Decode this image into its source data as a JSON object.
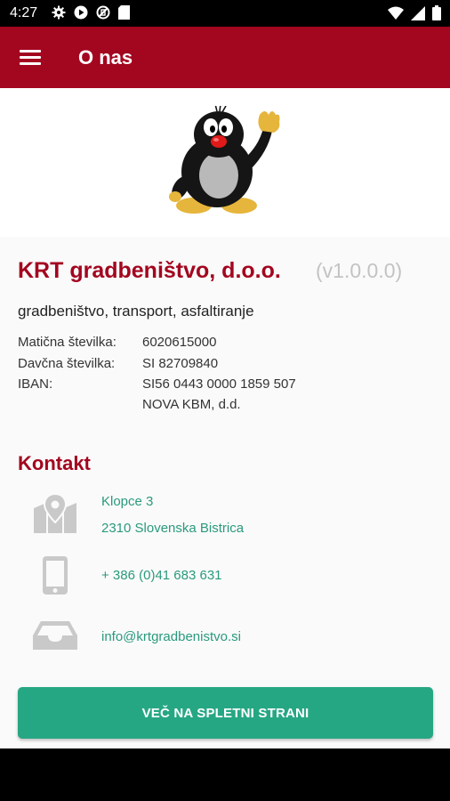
{
  "status_bar": {
    "time": "4:27",
    "left_icons": [
      "gear-icon",
      "play-icon",
      "no-sim-icon",
      "sd-card-icon"
    ],
    "right_icons": [
      "wifi-icon",
      "signal-icon",
      "battery-icon"
    ]
  },
  "app_bar": {
    "title": "O nas",
    "menu_icon": "hamburger-menu-icon",
    "background_color": "#a3061f"
  },
  "company": {
    "name": "KRT gradbeništvo, d.o.o.",
    "version": "(v1.0.0.0)",
    "tagline": "gradbeništvo, transport, asfaltiranje",
    "info": [
      {
        "label": "Matična številka:",
        "value": "6020615000"
      },
      {
        "label": "Davčna številka:",
        "value": "SI 82709840"
      },
      {
        "label": "IBAN:",
        "value": "SI56 0443 0000 1859 507"
      },
      {
        "label": "",
        "value": "NOVA KBM, d.d."
      }
    ]
  },
  "contact": {
    "title": "Kontakt",
    "address_line1": "Klopce 3",
    "address_line2": "2310 Slovenska Bistrica",
    "phone": "+ 386 (0)41 683 631",
    "email": "info@krtgradbenistvo.si",
    "link_color": "#2a9a7d"
  },
  "cta": {
    "label": "VEČ NA SPLETNI STRANI",
    "color": "#26a784"
  }
}
